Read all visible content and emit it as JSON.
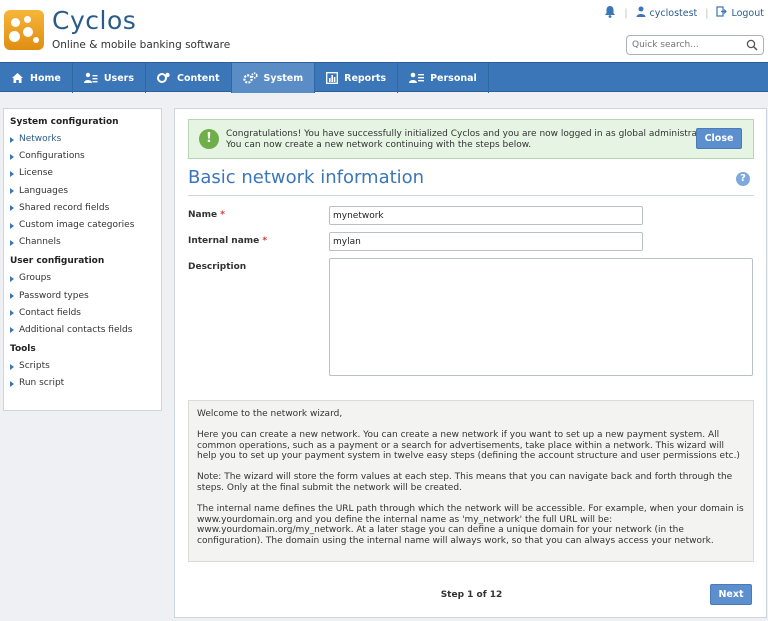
{
  "header": {
    "brand": "Cyclos",
    "tagline": "Online & mobile banking software",
    "username": "cyclostest",
    "logout_label": "Logout",
    "search_placeholder": "Quick search..."
  },
  "nav": {
    "items": [
      {
        "label": "Home",
        "icon": "home-icon"
      },
      {
        "label": "Users",
        "icon": "users-icon"
      },
      {
        "label": "Content",
        "icon": "content-icon"
      },
      {
        "label": "System",
        "icon": "system-icon"
      },
      {
        "label": "Reports",
        "icon": "reports-icon"
      },
      {
        "label": "Personal",
        "icon": "personal-icon"
      }
    ],
    "active": "System"
  },
  "sidebar": {
    "system_configuration": {
      "heading": "System configuration",
      "items": [
        "Networks",
        "Configurations",
        "License",
        "Languages",
        "Shared record fields",
        "Custom image categories",
        "Channels"
      ]
    },
    "user_configuration": {
      "heading": "User configuration",
      "items": [
        "Groups",
        "Password types",
        "Contact fields",
        "Additional contacts fields"
      ]
    },
    "tools": {
      "heading": "Tools",
      "items": [
        "Scripts",
        "Run script"
      ]
    }
  },
  "alert": {
    "line1": "Congratulations! You have successfully initialized Cyclos and you are now logged in as global administrator.",
    "line2": "You can now create a new network continuing with the steps below.",
    "close_label": "Close"
  },
  "form": {
    "title": "Basic network information",
    "help_symbol": "?",
    "name_label": "Name",
    "name_value": "mynetwork",
    "internal_name_label": "Internal name",
    "internal_name_value": "mylan",
    "description_label": "Description",
    "description_value": "",
    "required_mark": "*"
  },
  "info": {
    "p1": "Welcome to the network wizard,",
    "p2": "Here you can create a new network. You can create a new network if you want to set up a new payment system. All common operations, such as a payment or a search for advertisements, take place within a network. This wizard will help you to set up your payment system in twelve easy steps (defining the account structure and user permissions etc.)",
    "p3": "Note: The wizard will store the form values at each step. This means that you can navigate back and forth through the steps. Only at the final submit the network will be created.",
    "p4": "The internal name defines the URL path through which the network will be accessible. For example, when your domain is www.yourdomain.org and you define the internal name as 'my_network' the full URL will be: www.yourdomain.org/my_network. At a later stage you can define a unique domain for your network (in the configuration). The domain using the internal name will always work, so that you can always access your network."
  },
  "footer": {
    "step_label": "Step 1 of 12",
    "next_label": "Next"
  },
  "colors": {
    "nav_bar": "#3b76b8",
    "nav_active": "#5a8dc6",
    "brand_blue": "#2a5c8a",
    "button": "#5c8fcd",
    "success_bg": "#e6f4e4",
    "logo_orange": "#f0a128"
  }
}
